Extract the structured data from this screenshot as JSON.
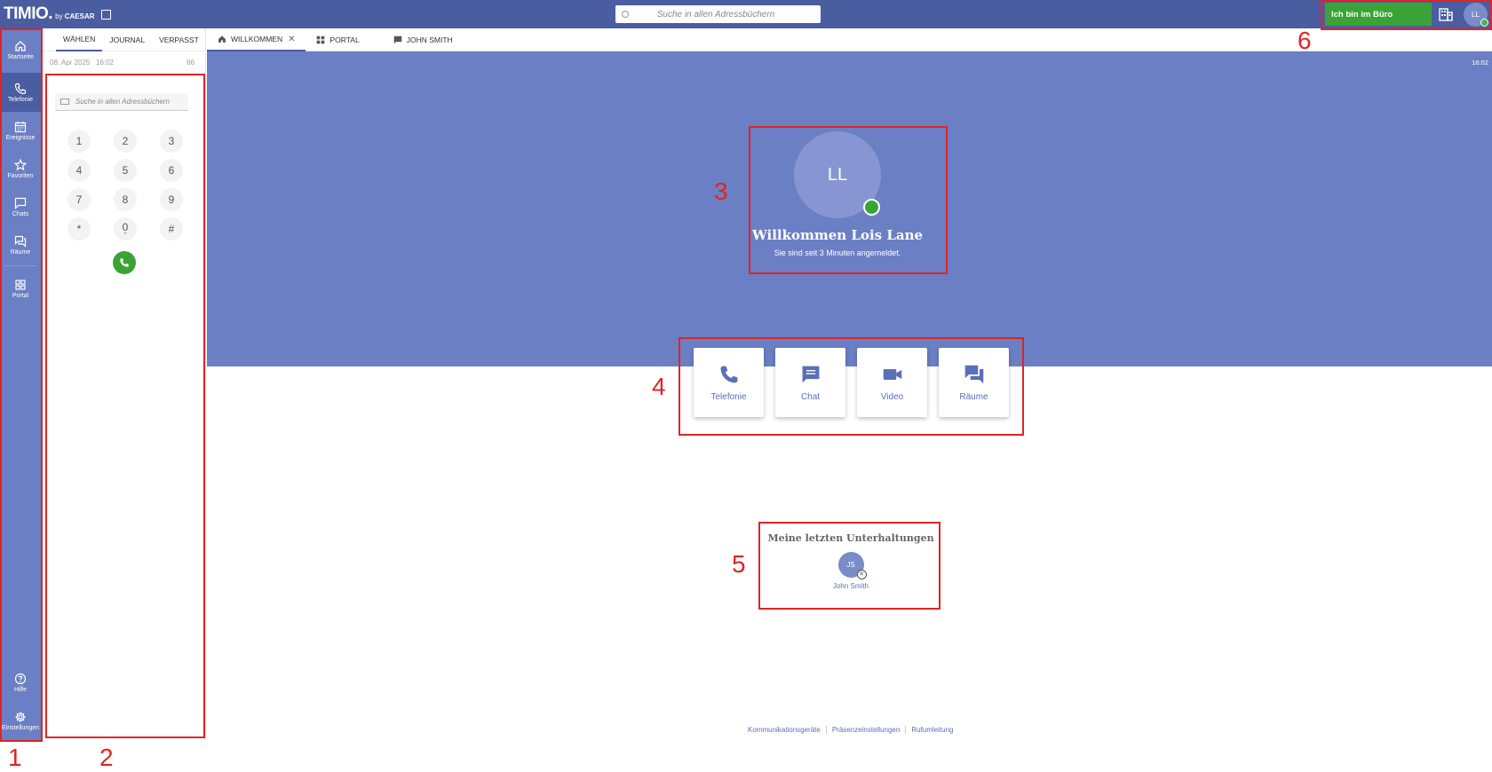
{
  "topbar": {
    "logo": "TIMIO.",
    "logo_by": "by",
    "logo_brand": "CAESAR",
    "search_placeholder": "Suche in allen Adressbüchern",
    "status_label": "Ich bin im Büro",
    "user_initials": "LL"
  },
  "sidebar": {
    "items": [
      {
        "label": "Startseite",
        "icon": "home-icon"
      },
      {
        "label": "Telefonie",
        "icon": "phone-icon"
      },
      {
        "label": "Ereignisse",
        "icon": "calendar-icon"
      },
      {
        "label": "Favoriten",
        "icon": "star-icon"
      },
      {
        "label": "Chats",
        "icon": "chat-icon"
      },
      {
        "label": "Räume",
        "icon": "rooms-icon"
      },
      {
        "label": "Portal",
        "icon": "grid-icon"
      }
    ],
    "bottom": [
      {
        "label": "Hilfe",
        "icon": "help-icon"
      },
      {
        "label": "Einstellungen",
        "icon": "gear-icon"
      }
    ]
  },
  "panel": {
    "tabs": [
      "WÄHLEN",
      "JOURNAL",
      "VERPASST"
    ],
    "date": "08. Apr 2025",
    "time": "16:02",
    "count": "66",
    "search_placeholder": "Suche in allen Adressbüchern",
    "keys": [
      [
        {
          "d": "1",
          "s": ""
        },
        {
          "d": "2",
          "s": ""
        },
        {
          "d": "3",
          "s": ""
        }
      ],
      [
        {
          "d": "4",
          "s": ""
        },
        {
          "d": "5",
          "s": ""
        },
        {
          "d": "6",
          "s": ""
        }
      ],
      [
        {
          "d": "7",
          "s": ""
        },
        {
          "d": "8",
          "s": ""
        },
        {
          "d": "9",
          "s": ""
        }
      ],
      [
        {
          "d": "*",
          "s": ""
        },
        {
          "d": "0",
          "s": "+"
        },
        {
          "d": "#",
          "s": ""
        }
      ]
    ]
  },
  "main_tabs": [
    {
      "label": "WILLKOMMEN",
      "icon": "home-icon"
    },
    {
      "label": "PORTAL",
      "icon": "grid-icon"
    },
    {
      "label": "JOHN SMITH",
      "icon": "chat-icon"
    }
  ],
  "hero": {
    "time": "16:02",
    "avatar": "LL",
    "title": "Willkommen Lois Lane",
    "subtitle": "Sie sind seit 3 Minuten angemeldet."
  },
  "cards": [
    {
      "label": "Telefonie",
      "icon": "phone-icon"
    },
    {
      "label": "Chat",
      "icon": "chat-icon"
    },
    {
      "label": "Video",
      "icon": "video-icon"
    },
    {
      "label": "Räume",
      "icon": "rooms-icon"
    }
  ],
  "recent": {
    "title": "Meine letzten Unterhaltungen",
    "contact_initials": "JS",
    "contact_name": "John Smith"
  },
  "footer": [
    "Kommunikationsgeräte",
    "Präsenzeinstellungen",
    "Rufumleitung"
  ],
  "annotations": [
    "1",
    "2",
    "3",
    "4",
    "5",
    "6"
  ],
  "colors": {
    "primary": "#4a5da0",
    "hero": "#6b7fc4",
    "status_green": "#3aa335",
    "highlight": "#e02424"
  }
}
